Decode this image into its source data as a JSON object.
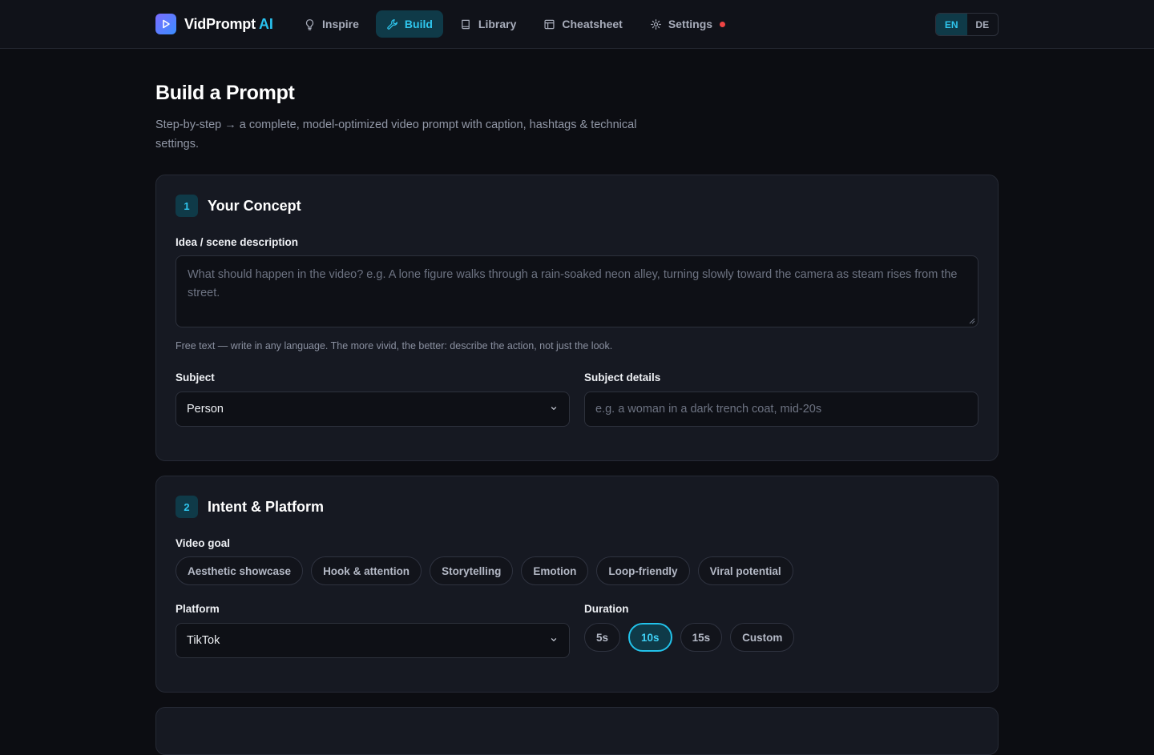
{
  "header": {
    "brand_name": "VidPrompt",
    "brand_suffix": "AI",
    "nav": [
      {
        "label": "Inspire",
        "icon": "lightbulb-icon",
        "active": false
      },
      {
        "label": "Build",
        "icon": "wrench-icon",
        "active": true
      },
      {
        "label": "Library",
        "icon": "book-icon",
        "active": false
      },
      {
        "label": "Cheatsheet",
        "icon": "layout-icon",
        "active": false
      },
      {
        "label": "Settings",
        "icon": "gear-icon",
        "active": false,
        "has_notification_dot": true
      }
    ],
    "languages": [
      {
        "label": "EN",
        "active": true
      },
      {
        "label": "DE",
        "active": false
      }
    ]
  },
  "page": {
    "title": "Build a Prompt",
    "subtitle": "Step-by-step → a complete, model-optimized video prompt with caption, hashtags & technical settings."
  },
  "concept": {
    "step": "1",
    "title": "Your Concept",
    "idea_label": "Idea / scene description",
    "idea_placeholder": "What should happen in the video? e.g. A lone figure walks through a rain-soaked neon alley, turning slowly toward the camera as steam rises from the street.",
    "idea_hint": "Free text — write in any language. The more vivid, the better: describe the action, not just the look.",
    "subject_label": "Subject",
    "subject_value": "Person",
    "details_label": "Subject details",
    "details_placeholder": "e.g. a woman in a dark trench coat, mid-20s"
  },
  "intent": {
    "step": "2",
    "title": "Intent & Platform",
    "goal_label": "Video goal",
    "goals": [
      "Aesthetic showcase",
      "Hook & attention",
      "Storytelling",
      "Emotion",
      "Loop-friendly",
      "Viral potential"
    ],
    "platform_label": "Platform",
    "platform_value": "TikTok",
    "duration_label": "Duration",
    "durations": [
      {
        "label": "5s",
        "active": false
      },
      {
        "label": "10s",
        "active": true
      },
      {
        "label": "15s",
        "active": false
      },
      {
        "label": "Custom",
        "active": false
      }
    ]
  },
  "colors": {
    "accent": "#22c2ea",
    "accent_bg": "#0f3a48",
    "notification": "#ef4444",
    "background": "#0c0d12",
    "card": "#161922"
  }
}
